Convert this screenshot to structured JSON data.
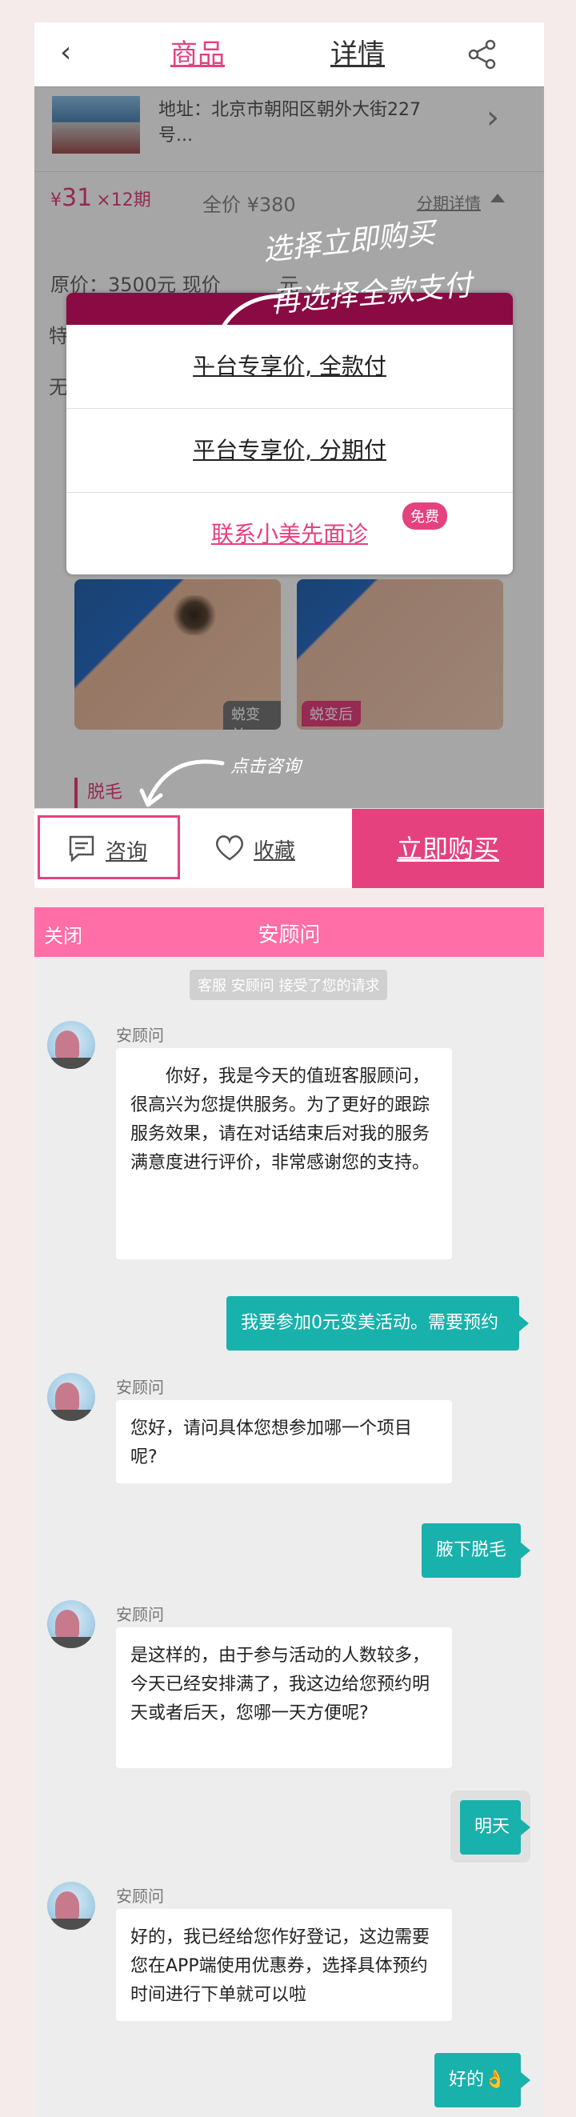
{
  "product": {
    "back_icon": "chevron-left-icon",
    "tabs": [
      "商品",
      "详情"
    ],
    "share_icon": "share-icon",
    "address": "地址：北京市朝阳区朝外大街227号...",
    "price_currency": "¥",
    "price_amount": "31",
    "price_periods": "×12期",
    "total_price": "全价 ¥380",
    "installment_detail": "分期详情",
    "original_price": "原价：3500元    现价",
    "original_price_tail": "元",
    "side_label_1": "特",
    "side_label_2": "无",
    "popup_options": [
      "平台专享价, 全款付",
      "平台专享价, 分期付",
      "联系小美先面诊"
    ],
    "free_badge": "免费",
    "photo_before": "蜕变前",
    "photo_after": "蜕变后",
    "notice_text": "脱毛",
    "consult_label": "咨询",
    "favorite_label": "收藏",
    "buy_label": "立即购买",
    "annotation_1": "选择立即购买",
    "annotation_2": "再选择全款支付",
    "annotation_3": "点击咨询",
    "accent_color": "#e5417f"
  },
  "chat": {
    "close_label": "关闭",
    "title": "安顾问",
    "system_notice": "客服 安顾问 接受了您的请求",
    "header_color": "#ff6ea6",
    "outgoing_color": "#19b1ab",
    "agent_name": "安顾问",
    "messages": [
      {
        "from": "agent",
        "text": "你好，我是今天的值班客服顾问，很高兴为您提供服务。为了更好的跟踪服务效果，请在对话结束后对我的服务满意度进行评价，非常感谢您的支持。"
      },
      {
        "from": "user",
        "text": "我要参加0元变美活动。需要预约"
      },
      {
        "from": "agent",
        "text": "您好，请问具体您想参加哪一个项目呢?"
      },
      {
        "from": "user",
        "text": "腋下脱毛"
      },
      {
        "from": "agent",
        "text": "是这样的，由于参与活动的人数较多，今天已经安排满了，我这边给您预约明天或者后天，您哪一天方便呢?"
      },
      {
        "from": "user",
        "text": "明天"
      },
      {
        "from": "agent",
        "text": "好的，我已经给您作好登记，这边需要您在APP端使用优惠券，选择具体预约时间进行下单就可以啦"
      },
      {
        "from": "user",
        "text": "好的👌"
      }
    ]
  }
}
